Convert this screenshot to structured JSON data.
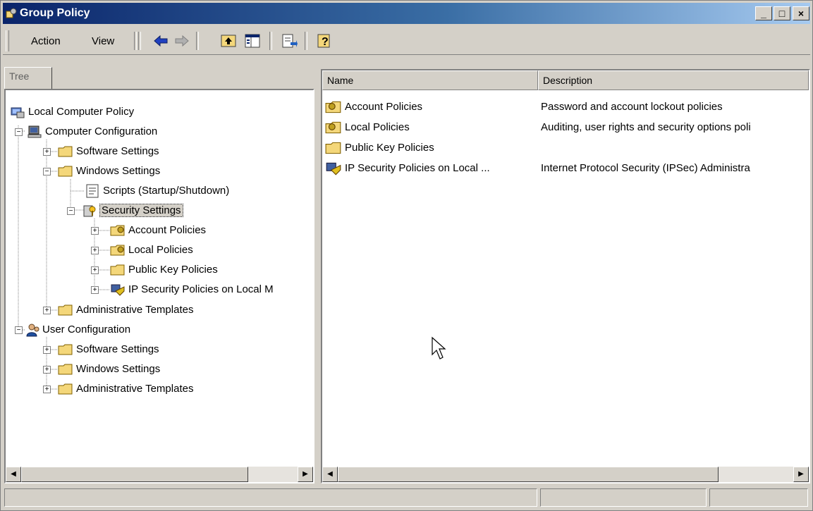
{
  "window": {
    "title": "Group Policy"
  },
  "menu": {
    "action": "Action",
    "view": "View"
  },
  "tab": {
    "label": "Tree"
  },
  "tree": [
    {
      "label": "Local Computer Policy",
      "icon": "computer-policy-icon"
    },
    {
      "label": "Computer Configuration",
      "icon": "computer-icon"
    },
    {
      "label": "Software Settings",
      "icon": "folder-icon"
    },
    {
      "label": "Windows Settings",
      "icon": "folder-icon"
    },
    {
      "label": "Scripts (Startup/Shutdown)",
      "icon": "script-icon"
    },
    {
      "label": "Security Settings",
      "icon": "security-icon"
    },
    {
      "label": "Account Policies",
      "icon": "folder-lock-icon"
    },
    {
      "label": "Local Policies",
      "icon": "folder-lock-icon"
    },
    {
      "label": "Public Key Policies",
      "icon": "folder-icon"
    },
    {
      "label": "IP Security Policies on Local M",
      "icon": "ip-security-icon"
    },
    {
      "label": "Administrative Templates",
      "icon": "folder-icon"
    },
    {
      "label": "User Configuration",
      "icon": "user-icon"
    },
    {
      "label": "Software Settings",
      "icon": "folder-icon"
    },
    {
      "label": "Windows Settings",
      "icon": "folder-icon"
    },
    {
      "label": "Administrative Templates",
      "icon": "folder-icon"
    }
  ],
  "list": {
    "columns": [
      "Name",
      "Description"
    ],
    "rows": [
      {
        "name": "Account Policies",
        "description": "Password and account lockout policies",
        "icon": "folder-lock-icon"
      },
      {
        "name": "Local Policies",
        "description": "Auditing, user rights and security options poli",
        "icon": "folder-lock-icon"
      },
      {
        "name": "Public Key Policies",
        "description": "",
        "icon": "folder-icon"
      },
      {
        "name": "IP Security Policies on Local ...",
        "description": "Internet Protocol Security (IPSec) Administra",
        "icon": "ip-security-icon"
      }
    ]
  },
  "colors": {
    "titlebar_start": "#0a246a",
    "titlebar_end": "#a6caf0",
    "face": "#d4d0c8",
    "folder": "#f4d77a"
  }
}
